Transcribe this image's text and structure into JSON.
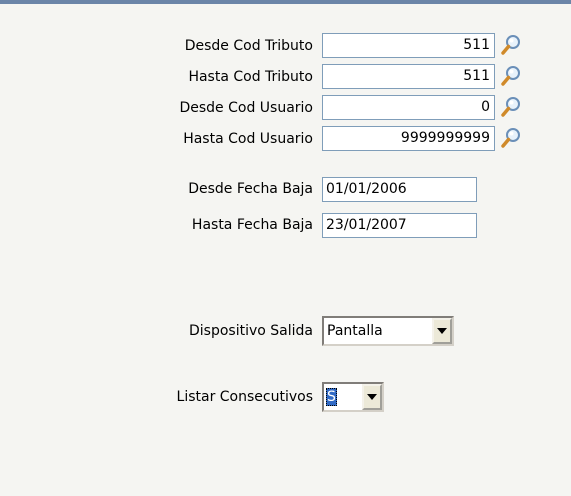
{
  "form": {
    "fields": [
      {
        "label": "Desde Cod Tributo",
        "value": "511",
        "lookup_icon": "magnifier-icon"
      },
      {
        "label": "Hasta Cod Tributo",
        "value": "511",
        "lookup_icon": "magnifier-icon"
      },
      {
        "label": "Desde Cod Usuario",
        "value": "0",
        "lookup_icon": "magnifier-icon"
      },
      {
        "label": "Hasta Cod Usuario",
        "value": "9999999999",
        "lookup_icon": "magnifier-icon"
      },
      {
        "label": "Desde Fecha Baja",
        "value": "01/01/2006"
      },
      {
        "label": "Hasta Fecha Baja",
        "value": "23/01/2007"
      }
    ],
    "dispositivo_salida": {
      "label": "Dispositivo Salida",
      "value": "Pantalla"
    },
    "listar_consecutivos": {
      "label": "Listar Consecutivos",
      "value": "S"
    }
  },
  "colors": {
    "top_border": "#6b85a8",
    "field_border": "#7f9db9",
    "background": "#f5f5f2",
    "selection": "#316ac5"
  }
}
